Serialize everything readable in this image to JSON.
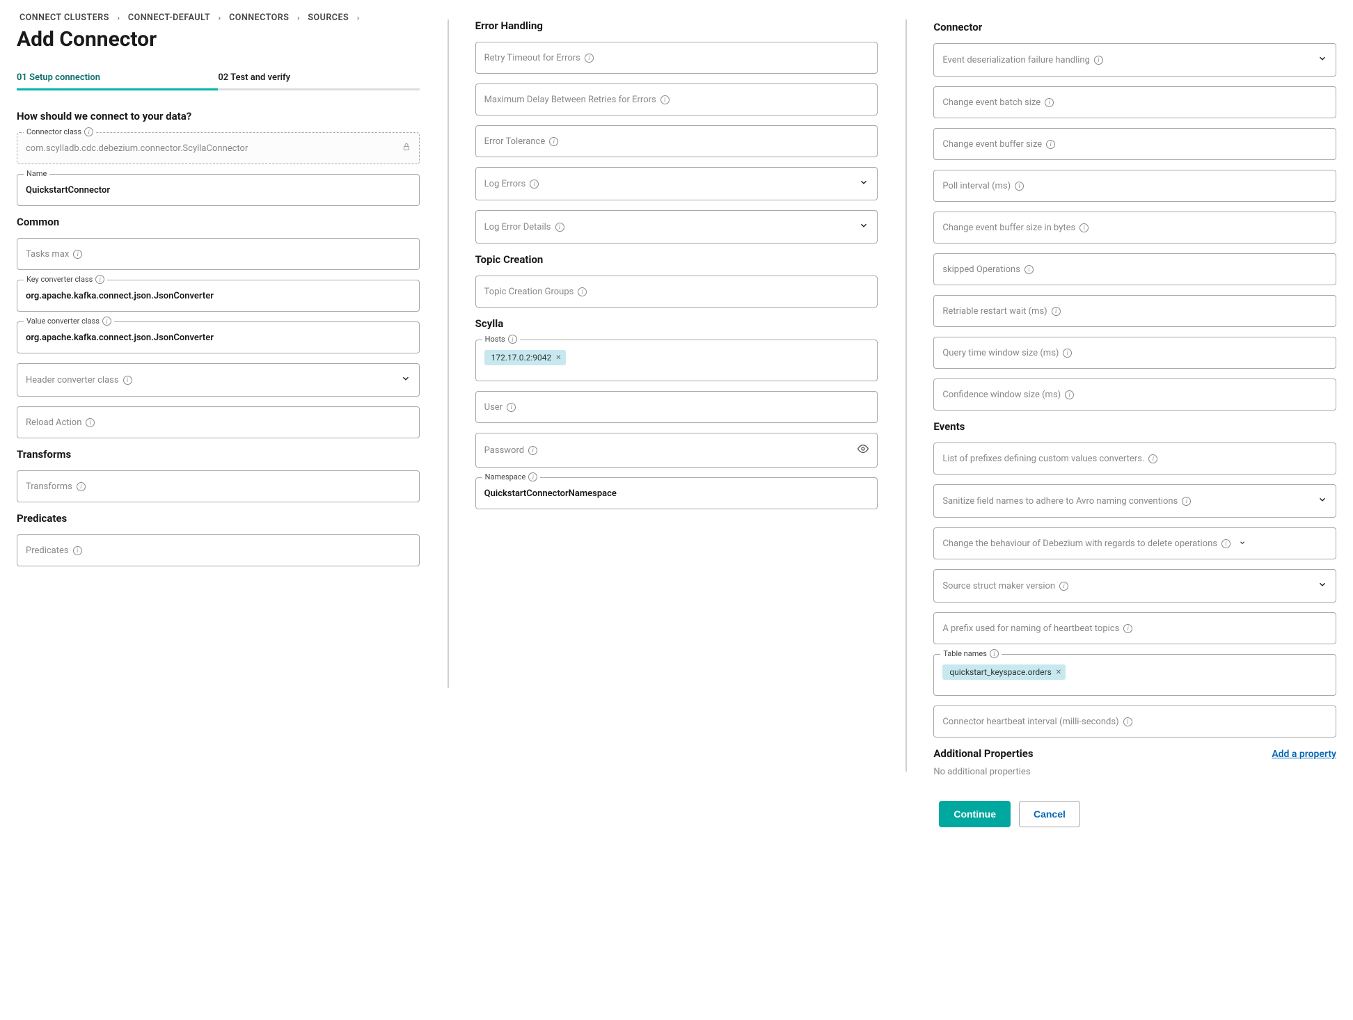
{
  "breadcrumb": [
    "CONNECT CLUSTERS",
    "CONNECT-DEFAULT",
    "CONNECTORS",
    "SOURCES"
  ],
  "page_title": "Add Connector",
  "stepper": {
    "step1": "01 Setup connection",
    "step2": "02 Test and verify"
  },
  "col1": {
    "question": "How should we connect to your data?",
    "connector_class_label": "Connector class",
    "connector_class_value": "com.scylladb.cdc.debezium.connector.ScyllaConnector",
    "name_label": "Name",
    "name_value": "QuickstartConnector",
    "common_heading": "Common",
    "tasks_max": "Tasks max",
    "key_conv_label": "Key converter class",
    "key_conv_value": "org.apache.kafka.connect.json.JsonConverter",
    "value_conv_label": "Value converter class",
    "value_conv_value": "org.apache.kafka.connect.json.JsonConverter",
    "header_conv": "Header converter class",
    "reload_action": "Reload Action",
    "transforms_heading": "Transforms",
    "transforms": "Transforms",
    "predicates_heading": "Predicates",
    "predicates": "Predicates"
  },
  "col2": {
    "error_heading": "Error Handling",
    "retry_timeout": "Retry Timeout for Errors",
    "max_delay": "Maximum Delay Between Retries for Errors",
    "error_tolerance": "Error Tolerance",
    "log_errors": "Log Errors",
    "log_error_details": "Log Error Details",
    "topic_creation_heading": "Topic Creation",
    "topic_creation_groups": "Topic Creation Groups",
    "scylla_heading": "Scylla",
    "hosts_label": "Hosts",
    "hosts_chip": "172.17.0.2:9042",
    "user": "User",
    "password": "Password",
    "namespace_label": "Namespace",
    "namespace_value": "QuickstartConnectorNamespace"
  },
  "col3": {
    "connector_heading": "Connector",
    "f1": "Event deserialization failure handling",
    "f2": "Change event batch size",
    "f3": "Change event buffer size",
    "f4": "Poll interval (ms)",
    "f5": "Change event buffer size in bytes",
    "f6": "skipped Operations",
    "f7": "Retriable restart wait (ms)",
    "f8": "Query time window size (ms)",
    "f9": "Confidence window size (ms)",
    "events_heading": "Events",
    "e1": "List of prefixes defining custom values converters.",
    "e2": "Sanitize field names to adhere to Avro naming conventions",
    "e3": "Change the behaviour of Debezium with regards to delete operations",
    "e4": "Source struct maker version",
    "e5": "A prefix used for naming of heartbeat topics",
    "table_names_label": "Table names",
    "table_names_chip": "quickstart_keyspace.orders",
    "e7": "Connector heartbeat interval (milli-seconds)",
    "additional_heading": "Additional Properties",
    "add_link": "Add a property",
    "no_additional": "No additional properties",
    "continue": "Continue",
    "cancel": "Cancel"
  }
}
